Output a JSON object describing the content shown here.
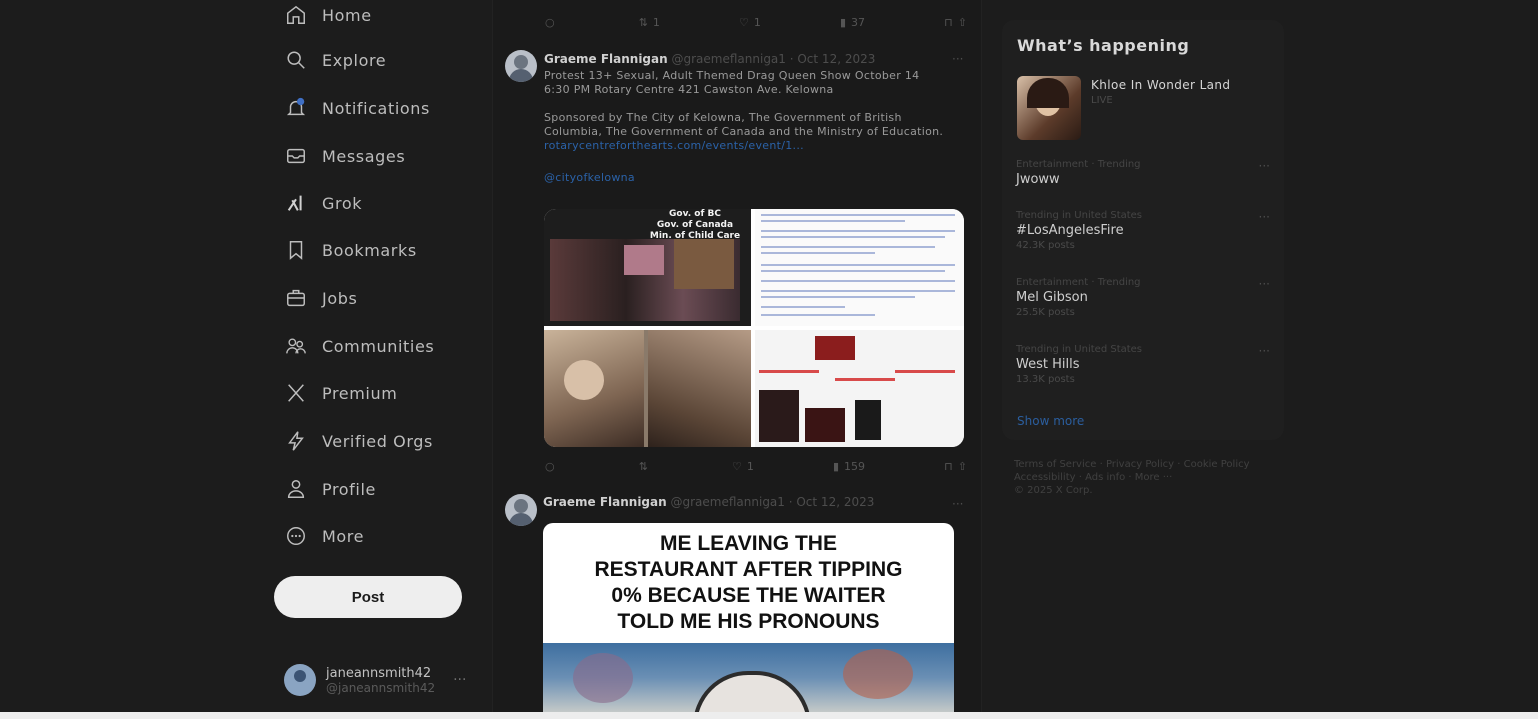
{
  "nav": {
    "items": [
      {
        "label": "Home",
        "icon": "home-icon"
      },
      {
        "label": "Explore",
        "icon": "search-icon"
      },
      {
        "label": "Notifications",
        "icon": "bell-icon"
      },
      {
        "label": "Messages",
        "icon": "envelope-icon"
      },
      {
        "label": "Grok",
        "icon": "grok-icon"
      },
      {
        "label": "Bookmarks",
        "icon": "bookmark-icon"
      },
      {
        "label": "Jobs",
        "icon": "briefcase-icon"
      },
      {
        "label": "Communities",
        "icon": "people-icon"
      },
      {
        "label": "Premium",
        "icon": "x-logo-icon"
      },
      {
        "label": "Verified Orgs",
        "icon": "lightning-icon"
      },
      {
        "label": "Profile",
        "icon": "person-icon"
      },
      {
        "label": "More",
        "icon": "more-circle-icon"
      }
    ],
    "post_label": "Post"
  },
  "account": {
    "name": "janeannsmith42",
    "handle": "@janeannsmith42",
    "more": "···"
  },
  "feed": {
    "top_actions": {
      "reply": "",
      "retweet": "1",
      "like": "1",
      "views": "37"
    },
    "tweet1": {
      "name": "Graeme Flannigan",
      "meta": "@graemeflannigа1 · Oct 12, 2023",
      "more": "···",
      "line1": "Protest 13+ Sexual, Adult Themed Drag Queen Show October 14",
      "line2": "6:30 PM Rotary Centre 421 Cawston Ave. Kelowna",
      "line3": "Sponsored by The City of Kelowna, The Government of British",
      "line4": "Columbia, The Government of Canada and the Ministry of Education.",
      "link": "rotarycentreforthearts.com/events/event/1...",
      "mention": "@cityofkelowna",
      "media_caption": "Gov. of BC\nGov. of Canada\nMin. of Child Care",
      "actions": {
        "reply": "",
        "retweet": "",
        "like": "1",
        "views": "159"
      }
    },
    "tweet2": {
      "name": "Graeme Flannigan",
      "meta": "@graemeflannigа1 · Oct 12, 2023",
      "more": "···",
      "meme_lines": [
        "ME LEAVING THE",
        "RESTAURANT AFTER TIPPING",
        "0% BECAUSE THE WAITER",
        "TOLD ME HIS PRONOUNS"
      ]
    }
  },
  "right": {
    "heading": "What’s happening",
    "live": {
      "title": "Khloe In Wonder Land",
      "status": "LIVE"
    },
    "trends": [
      {
        "context": "Entertainment · Trending",
        "topic": "Jwoww",
        "count": ""
      },
      {
        "context": "Trending in United States",
        "topic": "#LosAngelesFire",
        "count": "42.3K posts"
      },
      {
        "context": "Entertainment · Trending",
        "topic": "Mel Gibson",
        "count": "25.5K posts"
      },
      {
        "context": "Trending in United States",
        "topic": "West Hills",
        "count": "13.3K posts"
      }
    ],
    "show_more": "Show more",
    "footer_line1": "Terms of Service · Privacy Policy · Cookie Policy",
    "footer_line2": "Accessibility · Ads info · More ···",
    "footer_line3": "© 2025 X Corp."
  },
  "colors": {
    "background": "#1c1c1c",
    "link": "#2b62a8",
    "post_button": "#eeeeee"
  }
}
